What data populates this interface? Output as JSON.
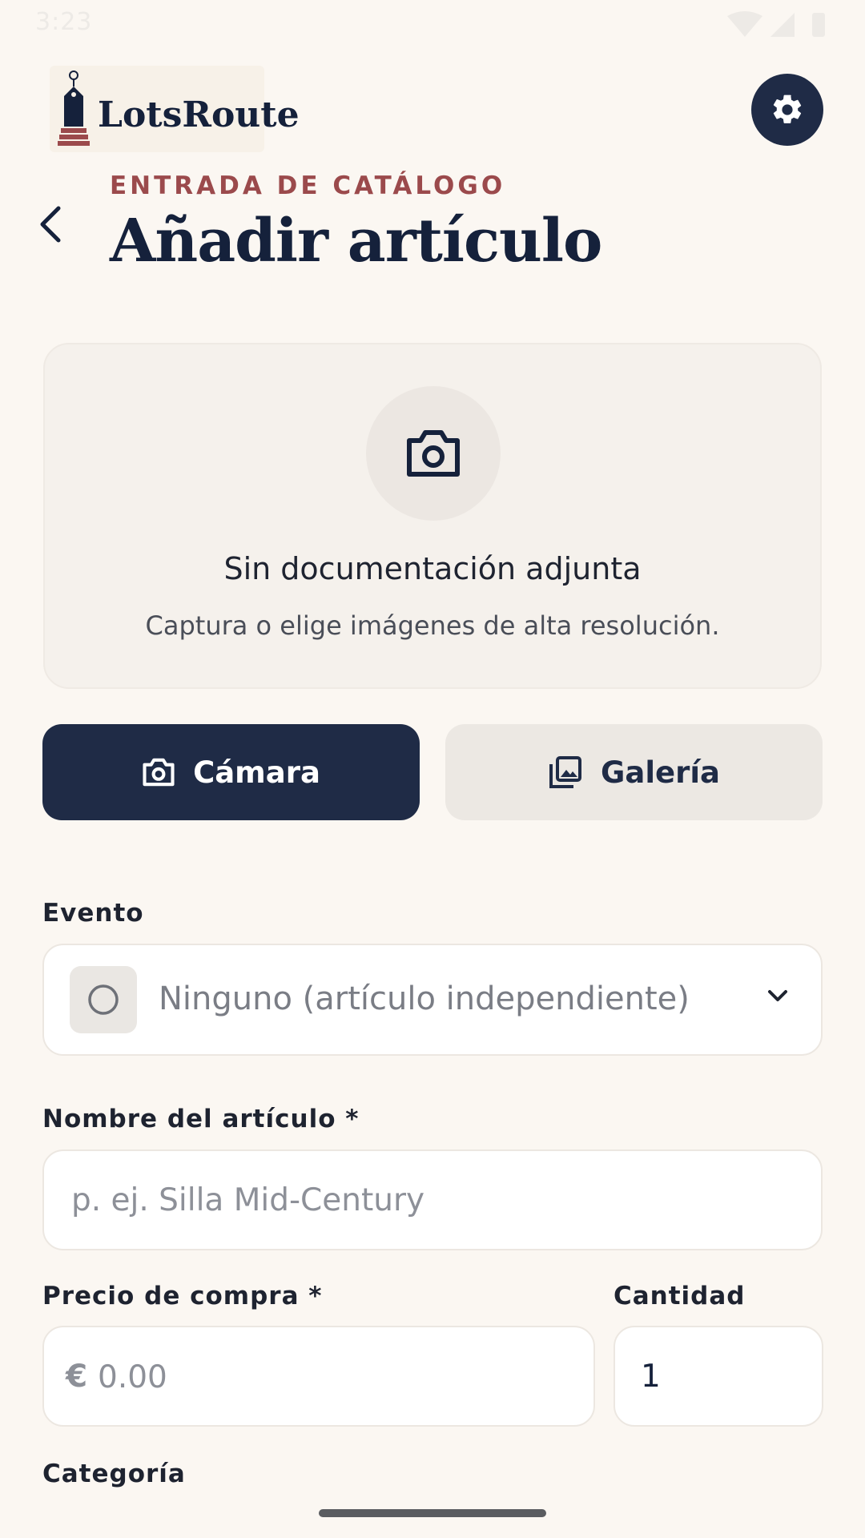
{
  "status_bar": {
    "time": "3:23"
  },
  "header": {
    "brand": "LotsRoute",
    "eyebrow": "ENTRADA DE CATÁLOGO",
    "title": "Añadir artículo"
  },
  "photo": {
    "title": "Sin documentación adjunta",
    "subtitle": "Captura o elige imágenes de alta resolución."
  },
  "buttons": {
    "camera": "Cámara",
    "gallery": "Galería"
  },
  "form": {
    "event_label": "Evento",
    "event_value": "Ninguno (artículo independiente)",
    "name_label": "Nombre del artículo *",
    "name_placeholder": "p. ej. Silla Mid-Century",
    "price_label": "Precio de compra *",
    "price_currency": "€",
    "price_placeholder": "0.00",
    "quantity_label": "Cantidad",
    "quantity_value": "1",
    "category_label": "Categoría"
  },
  "icons": {
    "settings": "gear-icon",
    "back": "chevron-left-icon",
    "photo": "camera-icon",
    "gallery": "gallery-icon",
    "event": "radio-empty-icon",
    "dropdown": "chevron-down-icon"
  },
  "colors": {
    "background": "#FBF7F2",
    "primary": "#1F2B46",
    "accent": "#9B4A4C"
  }
}
